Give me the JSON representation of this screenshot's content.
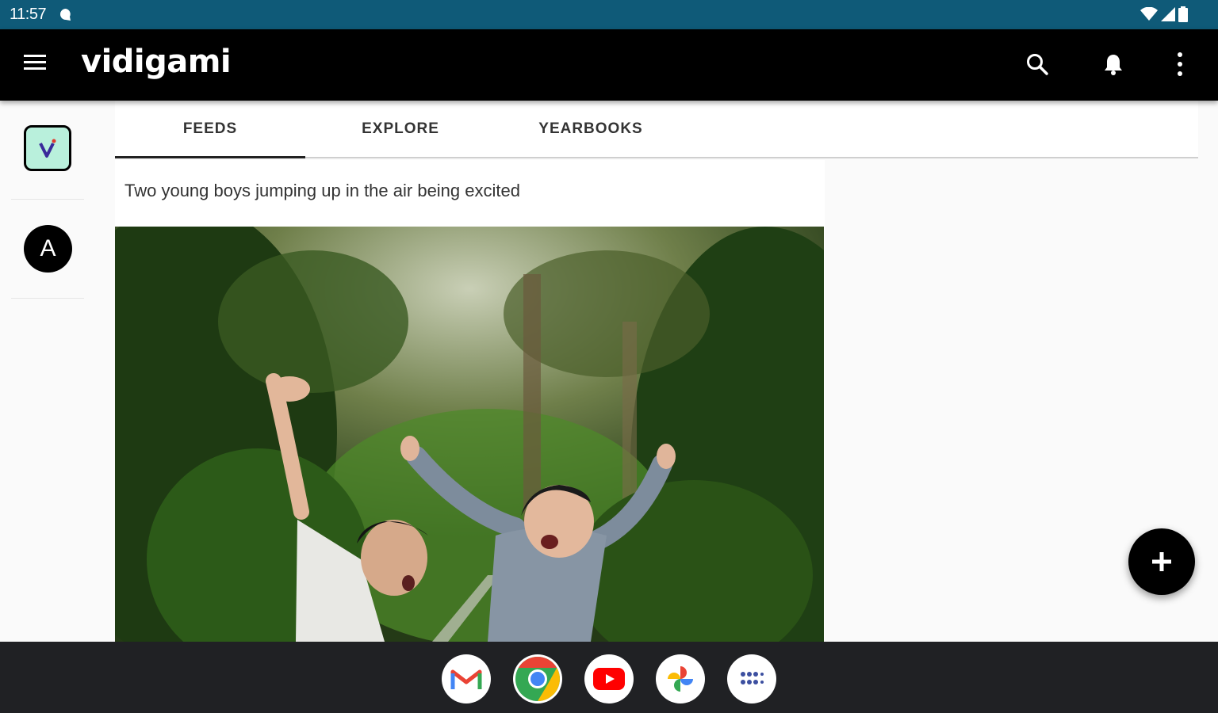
{
  "status_bar": {
    "time": "11:57"
  },
  "app_bar": {
    "brand": "vidigami"
  },
  "rail": {
    "avatar_letter": "A"
  },
  "tabs": [
    {
      "label": "FEEDS",
      "active": true
    },
    {
      "label": "EXPLORE",
      "active": false
    },
    {
      "label": "YEARBOOKS",
      "active": false
    }
  ],
  "post": {
    "caption": "Two young boys jumping up in the air being excited"
  },
  "dock": {
    "apps": [
      {
        "name": "Gmail",
        "icon": "gmail-icon"
      },
      {
        "name": "Chrome",
        "icon": "chrome-icon"
      },
      {
        "name": "YouTube",
        "icon": "youtube-icon"
      },
      {
        "name": "Photos",
        "icon": "photos-icon"
      },
      {
        "name": "App drawer",
        "icon": "app-drawer-icon"
      }
    ]
  },
  "colors": {
    "status_bar": "#0f5a78",
    "app_bar": "#000000",
    "rail_logo_bg": "#b9f0dc",
    "dock": "#202124"
  }
}
